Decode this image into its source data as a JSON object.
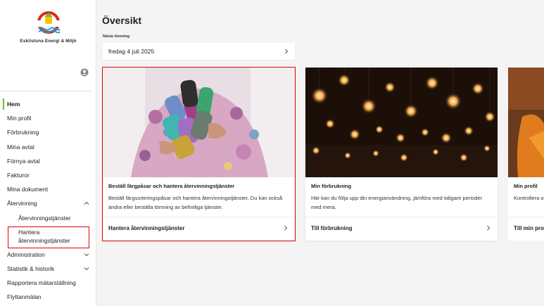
{
  "brand": {
    "name": "Eskilstuna Energi & Miljö",
    "colors": {
      "accent_green": "#6dbb2e",
      "logo_red": "#e1261c",
      "logo_blue": "#1aa3d8",
      "logo_yellow": "#f7c600",
      "highlight_red": "#e00000"
    }
  },
  "header": {
    "user_icon": "user-circle-icon"
  },
  "sidebar": {
    "items": [
      {
        "label": "Hem",
        "active": true
      },
      {
        "label": "Min profil"
      },
      {
        "label": "Förbrukning"
      },
      {
        "label": "Mina avtal"
      },
      {
        "label": "Förnya avtal"
      },
      {
        "label": "Fakturor"
      },
      {
        "label": "Mina dokument"
      },
      {
        "label": "Återvinning",
        "expanded": true,
        "icon": "chevron-up-icon"
      },
      {
        "label": "Återvinningstjänster",
        "sub": true
      },
      {
        "label": "Hantera återvinningstjänster",
        "sub": true,
        "highlighted": true
      },
      {
        "label": "Administration",
        "icon": "chevron-down-icon"
      },
      {
        "label": "Statistik & historik",
        "icon": "chevron-down-icon"
      },
      {
        "label": "Rapportera mätarställning"
      },
      {
        "label": "Flyttanmälan"
      }
    ]
  },
  "main": {
    "title": "Översikt",
    "next_emptying": {
      "label": "Nästa tömning",
      "date": "fredag 4 juli 2025"
    },
    "cards": [
      {
        "title": "Beställ färgpåsar och hantera återvinningstjänster",
        "description": "Beställ färgsorteringspåsar och hantera återvinningstjänster. Du kan också ändra eller beställa tömning av befintliga tjänster.",
        "link": "Hantera återvinningstjänster",
        "image": "colored-recycling-bags-photo"
      },
      {
        "title": "Min förbrukning",
        "description": "Här kan du följa upp din energianvändning, jämföra med tidigare perioder med mera.",
        "link": "Till förbrukning",
        "image": "warm-light-bulbs-photo"
      },
      {
        "title": "Min profil",
        "description": "Kontrollera och uppdatera dina uppgifter vid behov, och skapa fullmakt för att hantera dina ärenden vid tillfälle.",
        "link": "Till min profil",
        "image": "profile-photo"
      }
    ]
  }
}
